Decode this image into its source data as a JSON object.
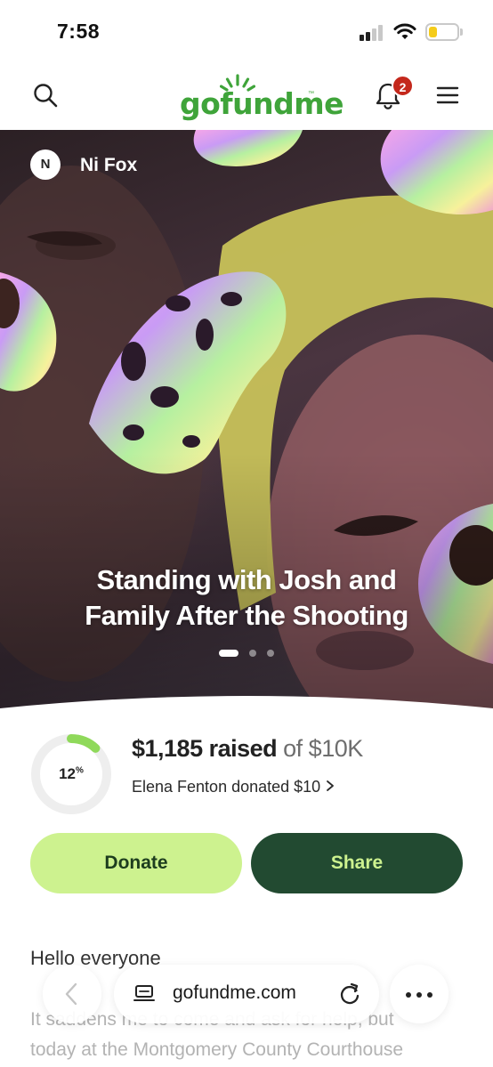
{
  "status_bar": {
    "time": "7:58",
    "battery_level": 0.3,
    "battery_color": "#f5cc1a"
  },
  "header": {
    "logo_text": "gofundme",
    "logo_tm": "™",
    "notification_count": "2",
    "brand_color": "#3fa43a",
    "badge_color": "#c4281c",
    "icons": [
      "search-icon",
      "bell-icon",
      "menu-icon"
    ]
  },
  "hero": {
    "owner_initial": "N",
    "owner_name": "Ni Fox",
    "title": "Standing with Josh and Family After the Shooting",
    "slide_count": 3,
    "active_slide": 1
  },
  "progress": {
    "percent": 12,
    "percent_label": "12",
    "percent_sign": "%",
    "raised": "$1,185 raised",
    "goal": "of $10K",
    "recent_donation": "Elena Fenton donated $10",
    "ring_color": "#8fd95a"
  },
  "actions": {
    "donate_label": "Donate",
    "share_label": "Share",
    "donate_color": "#cdf28f",
    "share_color": "#224a31"
  },
  "story": {
    "greeting": "Hello everyone",
    "lines": [
      "It saddens me to come and ask for help, but",
      "today at the Montgomery County Courthouse"
    ]
  },
  "browser": {
    "url": "gofundme.com",
    "icons": [
      "back-icon",
      "page-info-icon",
      "reload-icon",
      "more-icon"
    ]
  }
}
